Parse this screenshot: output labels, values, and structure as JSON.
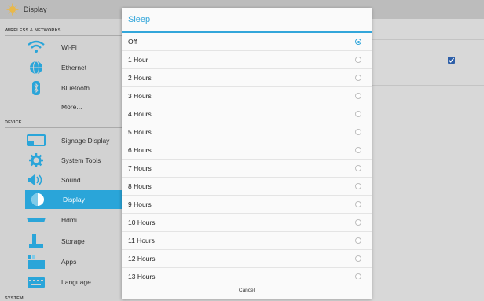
{
  "header": {
    "title": "Display"
  },
  "sidebar": {
    "sections": [
      {
        "label": "WIRELESS & NETWORKS"
      },
      {
        "label": "DEVICE"
      },
      {
        "label": "SYSTEM"
      }
    ],
    "items": [
      {
        "label": "Wi-Fi",
        "icon": "wifi-icon"
      },
      {
        "label": "Ethernet",
        "icon": "globe-icon"
      },
      {
        "label": "Bluetooth",
        "icon": "bluetooth-icon"
      },
      {
        "label": "More...",
        "icon": ""
      },
      {
        "label": "Signage Display",
        "icon": "signage-display-icon"
      },
      {
        "label": "System Tools",
        "icon": "gear-icon"
      },
      {
        "label": "Sound",
        "icon": "speaker-icon"
      },
      {
        "label": "Display",
        "icon": "display-icon",
        "active": true
      },
      {
        "label": "Hdmi",
        "icon": "hdmi-icon"
      },
      {
        "label": "Storage",
        "icon": "storage-icon"
      },
      {
        "label": "Apps",
        "icon": "apps-icon"
      },
      {
        "label": "Language",
        "icon": "keyboard-icon"
      }
    ]
  },
  "dialog": {
    "title": "Sleep",
    "options": [
      {
        "label": "Off",
        "selected": true
      },
      {
        "label": "1 Hour",
        "selected": false
      },
      {
        "label": "2 Hours",
        "selected": false
      },
      {
        "label": "3 Hours",
        "selected": false
      },
      {
        "label": "4 Hours",
        "selected": false
      },
      {
        "label": "5 Hours",
        "selected": false
      },
      {
        "label": "6 Hours",
        "selected": false
      },
      {
        "label": "7 Hours",
        "selected": false
      },
      {
        "label": "8 Hours",
        "selected": false
      },
      {
        "label": "9 Hours",
        "selected": false
      },
      {
        "label": "10 Hours",
        "selected": false
      },
      {
        "label": "11 Hours",
        "selected": false
      },
      {
        "label": "12 Hours",
        "selected": false
      },
      {
        "label": "13 Hours",
        "selected": false
      }
    ],
    "cancel_label": "Cancel"
  },
  "colors": {
    "accent": "#33a6da",
    "active_item": "#2aa5d9",
    "checkbox": "#2e5fa8"
  }
}
